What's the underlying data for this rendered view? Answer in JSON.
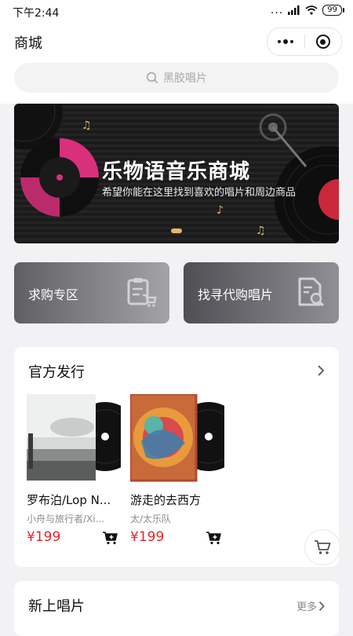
{
  "status": {
    "time": "下午2:44",
    "signal": "...",
    "battery": "99"
  },
  "nav": {
    "title": "商城"
  },
  "search": {
    "placeholder": "黑胶唱片"
  },
  "banner": {
    "title": "乐物语音乐商城",
    "subtitle": "希望你能在这里找到喜欢的唱片和周边商品"
  },
  "categories": [
    {
      "label": "求购专区",
      "icon": "clipboard-cart-icon"
    },
    {
      "label": "找寻代购唱片",
      "icon": "document-search-icon"
    }
  ],
  "official": {
    "title": "官方发行",
    "items": [
      {
        "title": "罗布泊/Lop N...",
        "artist": "小舟与旅行者/Xi...",
        "price": "¥199"
      },
      {
        "title": "游走的去西方",
        "artist": "太/太乐队",
        "price": "¥199"
      }
    ]
  },
  "new_records": {
    "title": "新上唱片",
    "more": "更多"
  },
  "colors": {
    "price": "#e3262b",
    "background": "#f2f2f4"
  }
}
